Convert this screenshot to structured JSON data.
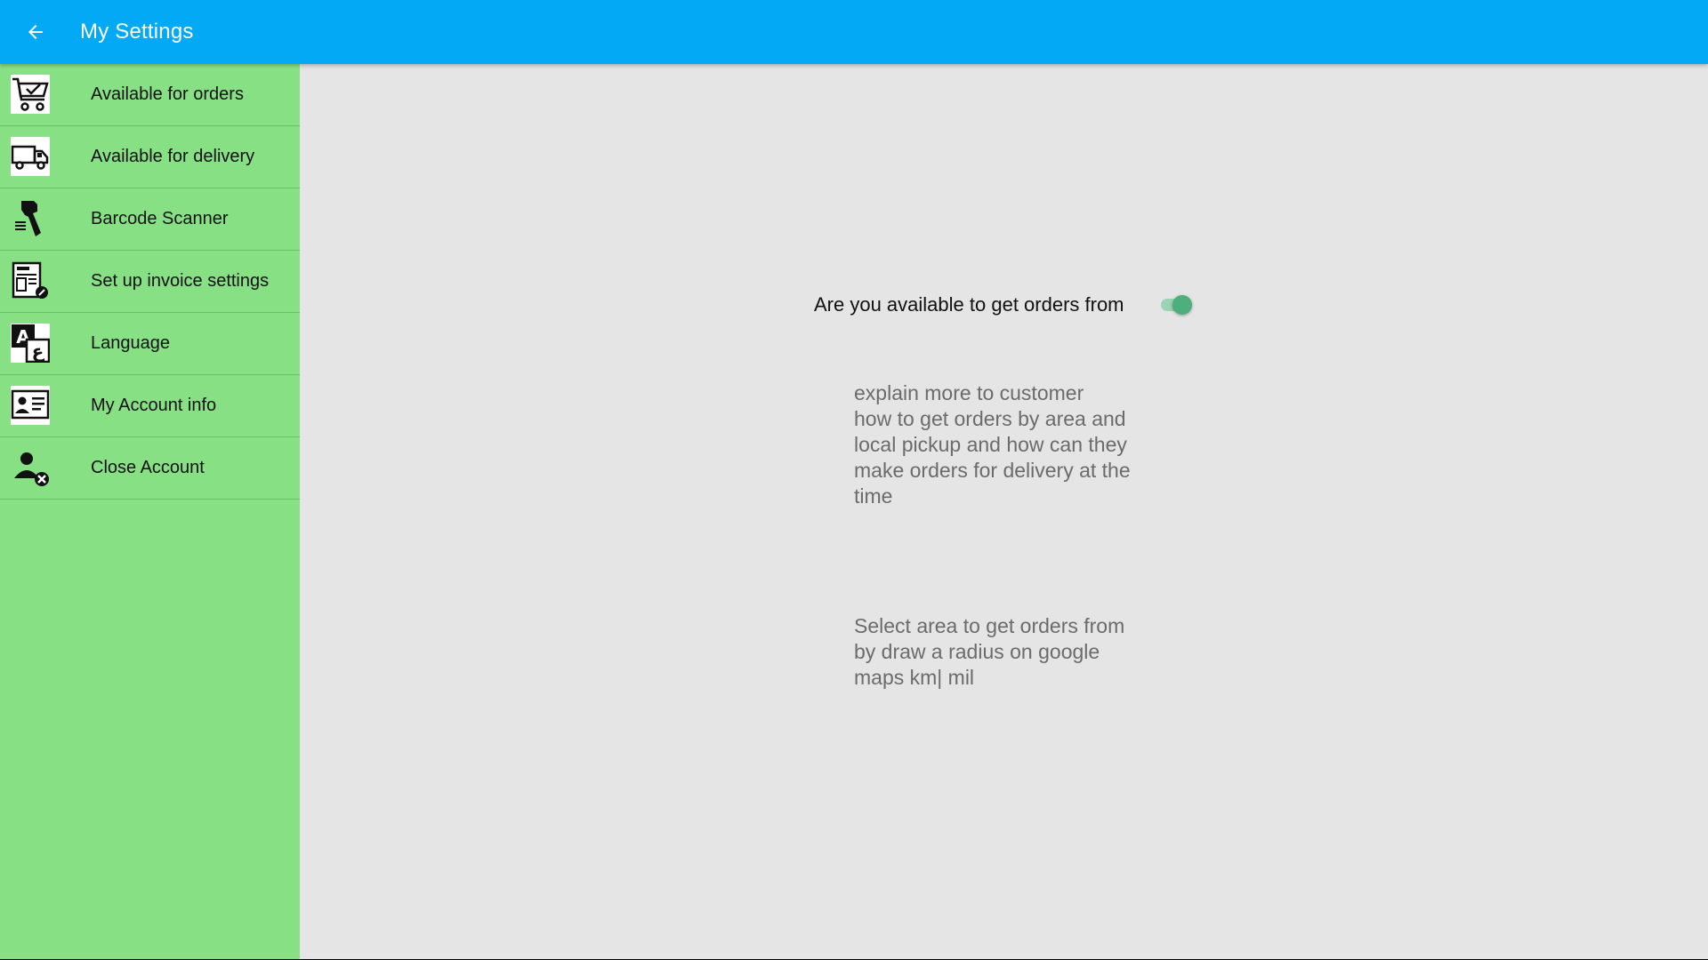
{
  "appbar": {
    "title": "My Settings",
    "back_icon": "arrow-left-icon",
    "color": "#03a9f4"
  },
  "sidebar": {
    "color": "#88e085",
    "items": [
      {
        "label": "Available for orders",
        "icon": "shopping-cart-check-icon"
      },
      {
        "label": "Available for delivery",
        "icon": "delivery-truck-icon"
      },
      {
        "label": "Barcode Scanner",
        "icon": "barcode-scanner-icon"
      },
      {
        "label": "Set up invoice settings",
        "icon": "invoice-settings-icon"
      },
      {
        "label": "Language",
        "icon": "language-translate-icon"
      },
      {
        "label": "My Account info",
        "icon": "id-card-icon"
      },
      {
        "label": "Close Account",
        "icon": "user-remove-icon"
      }
    ]
  },
  "main": {
    "availability_label": "Are you available to get orders from",
    "availability_on": true,
    "toggle_color": "#4caf7d",
    "help_text_1": "explain more to customer\nhow to get orders by area and\nlocal pickup and how can they\nmake orders for delivery at the\ntime",
    "help_text_2": "Select area to get orders from\nby draw a radius on google\nmaps km| mil"
  }
}
